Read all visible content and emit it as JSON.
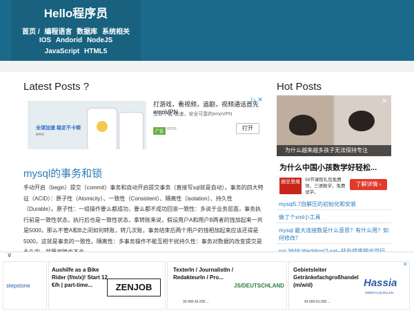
{
  "header": {
    "site_title": "Hello程序员",
    "nav_row1": [
      "首页 /",
      "编程语言",
      "数据库",
      "系统相关"
    ],
    "nav_row2": [
      "IOS",
      "Andorid",
      "NodeJS"
    ],
    "nav_row3": [
      "JavaScript",
      "HTML5"
    ]
  },
  "latest": {
    "title": "Latest Posts ?",
    "ad": {
      "headline": "打游戏，看视频，追剧，视频通话首先emoVPN",
      "sub": "立即下载-极速，安全可靠的emoVPN",
      "badge": "广告",
      "brand": "emo",
      "open_label": "打开",
      "img_line1": "全球加速 稳定不卡顿",
      "img_line2": "emo"
    },
    "post": {
      "title": "mysql的事务和锁",
      "body": "手动开启（begin）提交（commit）事务和自动开启提交事务（直接写sql就是自动）。事务的四大特征（ACID）：原子性（Atomicity）、一致性（Consistent）、隔离性（isolation）、持久性（Durable）。原子性：一组操作要么都成功，要么都不成功回滚一致性：多说于业务层面，事务执行前是一致性状态，执行后也是一致性状态，拿转账来说，假设用户A和用户B两者的钱加起来一共是5000，那么不管A和B之间如何转账，转几次账，事务结束后两个用户的钱相加起来应该还得是5000，这就是事务的一致性。隔离性：多事务操作不能互相干扰持久性：事务对数据的改变提交是永久的，就算故障也不会..."
    }
  },
  "hot": {
    "title": "Hot Posts",
    "ad_caption": "为什么越来越多孩子无法保持专注",
    "headline": "为什么中国小孩数学好轻松...",
    "logo_text": "豌豆思维",
    "desc": "59节课程礼包免费领，三语数学，免费试学。",
    "button": "了解详情 ›",
    "items": [
      "mysql5.7自解压的初始化和安装",
      "做了个xml小工具",
      "mysql 最大连接数是什么意思？有什么用？如何修改？",
      "poj 3648 Wedding(2-sat--托扑排序输出可行"
    ]
  },
  "bottom_ads": {
    "collapse": "∨",
    "stepstone": "stepstone",
    "zenjob_text": "Aushilfe as a Bike Rider (f/m/x)! Start 12 €/h | part-time...",
    "zenjob_logo": "ZENJOB",
    "texter_title": "TexterIn / JournalistIn / RedakteurIn / Pro...",
    "texter_logo": "JS/DEUTSCHLAND",
    "texter_salary": "32.400-43.200 ...",
    "hassia_title": "Gebietsleiter Getränkefachgroßhandel (m/w/d)",
    "hassia_logo": "Hassia",
    "hassia_sub": "MINERALQUELLEN",
    "hassia_salary": "43.000-61.000 ...",
    "close": "✕"
  }
}
